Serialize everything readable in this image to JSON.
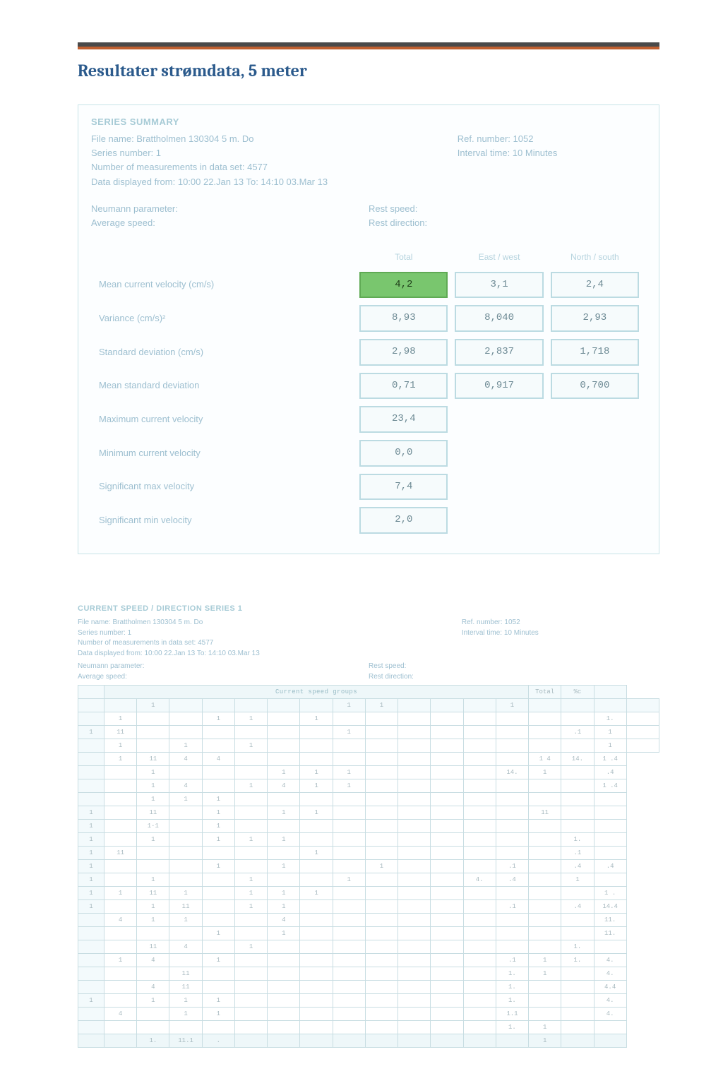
{
  "title": "Resultater strømdata, 5 meter",
  "summary1": {
    "header": "SERIES SUMMARY",
    "file": "File name: Brattholmen 130304 5 m.  Do",
    "series": "Series number: 1",
    "num": "Number of measurements in data set: 4577",
    "range": "Data displayed from: 10:00  22.Jan 13   To: 14:10   03.Mar 13",
    "ref": "Ref. number: 1052",
    "interval": "Interval time: 10 Minutes",
    "np": "Neumann parameter:",
    "as": "Average speed:",
    "rs": "Rest speed:",
    "rd": "Rest direction:",
    "cols": [
      "Total",
      "East / west",
      "North / south"
    ],
    "rows": [
      {
        "label": "Mean current velocity (cm/s)",
        "c": [
          "4,2",
          "3,1",
          "2,4"
        ],
        "hl": 0
      },
      {
        "label": "Variance (cm/s)²",
        "c": [
          "8,93",
          "8,040",
          "2,93"
        ]
      },
      {
        "label": "Standard deviation (cm/s)",
        "c": [
          "2,98",
          "2,837",
          "1,718"
        ]
      },
      {
        "label": "Mean standard deviation",
        "c": [
          "0,71",
          "0,917",
          "0,700"
        ]
      },
      {
        "label": "Maximum current velocity",
        "c": [
          "23,4",
          "",
          ""
        ]
      },
      {
        "label": "Minimum current velocity",
        "c": [
          "0,0",
          "",
          ""
        ]
      },
      {
        "label": "Significant max velocity",
        "c": [
          "7,4",
          "",
          ""
        ]
      },
      {
        "label": "Significant min velocity",
        "c": [
          "2,0",
          "",
          ""
        ]
      }
    ]
  },
  "summary2": {
    "header": "CURRENT SPEED / DIRECTION  SERIES  1",
    "file": "File name: Brattholmen 130304 5 m.  Do",
    "series": "Series number: 1",
    "num": "Number of measurements in data set: 4577",
    "range": "Data displayed from: 10:00  22.Jan 13   To: 14:10   03.Mar 13",
    "ref": "Ref. number: 1052",
    "interval": "Interval time: 10 Minutes",
    "np": "Neumann parameter:",
    "as": "Average speed:",
    "rs": "Rest speed:",
    "rd": "Rest direction:"
  },
  "matrix": {
    "section_left": "Current speed groups",
    "top": [
      "",
      "1",
      "",
      "",
      "",
      "",
      "",
      "1",
      "1",
      "",
      "",
      "",
      "1",
      "",
      ""
    ],
    "right_head": [
      "Total",
      "%c"
    ],
    "rows": [
      [
        "",
        "1",
        "",
        "",
        "1",
        "1",
        "",
        "1",
        "",
        "",
        "",
        "",
        "",
        "",
        "",
        "",
        "1.",
        ""
      ],
      [
        "1",
        "11",
        "",
        "",
        "",
        "",
        "",
        "",
        "1",
        "",
        "",
        "",
        "",
        "",
        "",
        ".1",
        "1",
        ""
      ],
      [
        "",
        "1",
        "",
        "1",
        "",
        "1",
        "",
        "",
        "",
        "",
        "",
        "",
        "",
        "",
        "",
        "",
        "1",
        ""
      ],
      [
        "",
        "1",
        "11",
        "4",
        "4",
        "",
        "",
        "",
        "",
        "",
        "",
        "",
        "",
        "",
        "1  4",
        "14.",
        "1 .4"
      ],
      [
        "",
        "",
        "1",
        "",
        "",
        "",
        "1",
        "1",
        "1",
        "",
        "",
        "",
        "",
        "14.",
        "1",
        "",
        ".4"
      ],
      [
        "",
        "",
        "1",
        "4",
        "",
        "1",
        "4",
        "1",
        "1",
        "",
        "",
        "",
        "",
        "",
        "",
        "",
        "1 .4"
      ],
      [
        "",
        "",
        "1",
        "1",
        "1",
        "",
        "",
        "",
        "",
        "",
        "",
        "",
        "",
        "",
        "",
        "",
        ""
      ],
      [
        "1",
        "",
        "11",
        "",
        "1",
        "",
        "1",
        "1",
        "",
        "",
        "",
        "",
        "",
        "",
        "11",
        "",
        ""
      ],
      [
        "1",
        "",
        "1·1",
        "",
        "1",
        "",
        "",
        "",
        "",
        "",
        "",
        "",
        "",
        "",
        "",
        "",
        ""
      ],
      [
        "1",
        "",
        "1",
        "",
        "1",
        "1",
        "1",
        "",
        "",
        "",
        "",
        "",
        "",
        "",
        "",
        "1.",
        ""
      ],
      [
        "1",
        "11",
        "",
        "",
        "",
        "",
        "",
        "1",
        "",
        "",
        "",
        "",
        "",
        "",
        "",
        ".1",
        ""
      ],
      [
        "1",
        "",
        "",
        "",
        "1",
        "",
        "1",
        "",
        "",
        "1",
        "",
        "",
        "",
        ".1",
        "",
        ".4",
        ".4"
      ],
      [
        "1",
        "",
        "1",
        "",
        "",
        "1",
        "",
        "",
        "1",
        "",
        "",
        "",
        "4.",
        ".4",
        "",
        "1",
        ""
      ],
      [
        "1",
        "1",
        "11",
        "1",
        "",
        "1",
        "1",
        "1",
        "",
        "",
        "",
        "",
        "",
        "",
        "",
        "",
        "1 ."
      ],
      [
        "1",
        "",
        "1",
        "11",
        "",
        "1",
        "1",
        "",
        "",
        "",
        "",
        "",
        "",
        ".1",
        "",
        ".4",
        "14.4"
      ],
      [
        "",
        "4",
        "1",
        "1",
        "",
        "",
        "4",
        "",
        "",
        "",
        "",
        "",
        "",
        "",
        "",
        "",
        "11."
      ],
      [
        "",
        "",
        "",
        "",
        "1",
        "",
        "1",
        "",
        "",
        "",
        "",
        "",
        "",
        "",
        "",
        "",
        "11."
      ],
      [
        "",
        "",
        "11",
        "4",
        "",
        "1",
        "",
        "",
        "",
        "",
        "",
        "",
        "",
        "",
        "",
        "1.",
        ""
      ],
      [
        "",
        "1",
        "4",
        "",
        "1",
        "",
        "",
        "",
        "",
        "",
        "",
        "",
        "",
        ".1",
        "1",
        "1.",
        "4."
      ],
      [
        "",
        "",
        "",
        "11",
        "",
        "",
        "",
        "",
        "",
        "",
        "",
        "",
        "",
        "1.",
        "1",
        "",
        "4."
      ],
      [
        "",
        "",
        "4",
        "11",
        "",
        "",
        "",
        "",
        "",
        "",
        "",
        "",
        "",
        "1.",
        "",
        "",
        "4.4"
      ],
      [
        "1",
        "",
        "1",
        "1",
        "1",
        "",
        "",
        "",
        "",
        "",
        "",
        "",
        "",
        "1.",
        "",
        "",
        "4."
      ],
      [
        "",
        "4",
        "",
        "1",
        "1",
        "",
        "",
        "",
        "",
        "",
        "",
        "",
        "",
        "1.1",
        "",
        "",
        "4."
      ],
      [
        "",
        "",
        "",
        "",
        "",
        "",
        "",
        "",
        "",
        "",
        "",
        "",
        "",
        "1.",
        "1",
        "",
        ""
      ]
    ],
    "last": [
      "",
      "",
      "1.",
      "11.1",
      ".",
      "",
      "",
      "",
      "",
      "",
      "",
      "",
      "",
      "",
      "1",
      "",
      ""
    ]
  }
}
